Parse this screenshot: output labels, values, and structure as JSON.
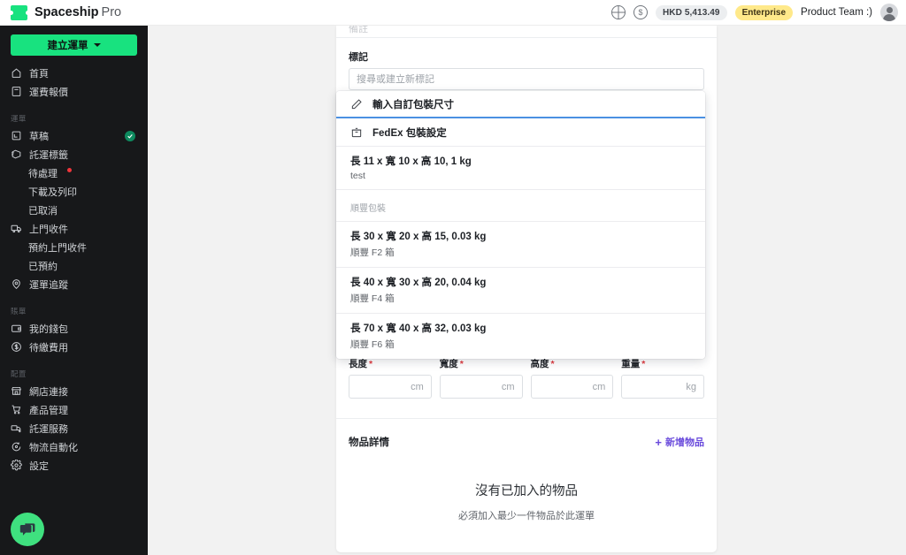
{
  "topbar": {
    "brand_bold": "Spaceship",
    "brand_light": "Pro",
    "globe_icon": "globe-icon",
    "currency_icon": "dollar-circle-icon",
    "balance": "HKD 5,413.49",
    "plan": "Enterprise",
    "user": "Product Team :)",
    "avatar_icon": "user-avatar-icon"
  },
  "sidebar": {
    "create_button": "建立運單",
    "primary": [
      {
        "label": "首頁",
        "icon": "home-icon"
      },
      {
        "label": "運費報價",
        "icon": "calculator-icon"
      }
    ],
    "groups": [
      {
        "label": "運單",
        "items": [
          {
            "label": "草稿",
            "icon": "draft-icon",
            "badge": "check"
          },
          {
            "label": "託運標籤",
            "icon": "label-tag-icon"
          },
          {
            "label": "待處理",
            "sub": true,
            "badge": "dot"
          },
          {
            "label": "下載及列印",
            "sub": true
          },
          {
            "label": "已取消",
            "sub": true
          },
          {
            "label": "上門收件",
            "icon": "truck-icon"
          },
          {
            "label": "預約上門收件",
            "sub": true
          },
          {
            "label": "已預約",
            "sub": true
          },
          {
            "label": "運單追蹤",
            "icon": "location-pin-icon"
          }
        ]
      },
      {
        "label": "賬單",
        "items": [
          {
            "label": "我的錢包",
            "icon": "wallet-icon"
          },
          {
            "label": "待繳費用",
            "icon": "dollar-circle-icon"
          }
        ]
      },
      {
        "label": "配置",
        "items": [
          {
            "label": "網店連接",
            "icon": "storefront-icon"
          },
          {
            "label": "產品管理",
            "icon": "cart-icon"
          },
          {
            "label": "託運服務",
            "icon": "shipping-service-icon"
          },
          {
            "label": "物流自動化",
            "icon": "automation-icon"
          },
          {
            "label": "設定",
            "icon": "gear-icon"
          }
        ]
      }
    ],
    "chat_icon": "chat-bubble-icon"
  },
  "form": {
    "clipped_label": "備註",
    "tag_label": "標記",
    "tag_placeholder": "搜尋或建立新標記",
    "package_select_value": "輸入自訂包裝尺寸",
    "dims": [
      {
        "label": "長度",
        "required": "*",
        "unit": "cm",
        "value": ""
      },
      {
        "label": "寬度",
        "required": "*",
        "unit": "cm",
        "value": ""
      },
      {
        "label": "高度",
        "required": "*",
        "unit": "cm",
        "value": ""
      },
      {
        "label": "重量",
        "required": "*",
        "unit": "kg",
        "value": ""
      }
    ]
  },
  "dropdown": {
    "custom_entry": {
      "label": "輸入自訂包裝尺寸",
      "icon": "pencil-icon"
    },
    "fedex_entry": {
      "label": "FedEx 包裝設定",
      "icon": "package-box-icon"
    },
    "saved": [
      {
        "title": "長 11 x 寬 10 x 高 10, 1 kg",
        "subtitle": "test"
      }
    ],
    "group_label": "順豐包裝",
    "group_options": [
      {
        "title": "長 30 x 寬 20 x 高 15, 0.03 kg",
        "subtitle": "順豐 F2 箱"
      },
      {
        "title": "長 40 x 寬 30 x 高 20, 0.04 kg",
        "subtitle": "順豐 F4 箱"
      },
      {
        "title": "長 70 x 寬 40 x 高 32, 0.03 kg",
        "subtitle": "順豐 F6 箱"
      }
    ]
  },
  "items_section": {
    "title": "物品詳情",
    "add_label": "新增物品",
    "add_icon": "plus-icon",
    "empty_title": "沒有已加入的物品",
    "empty_subtitle": "必須加入最少一件物品於此運單"
  },
  "colors": {
    "accent_green": "#18e27f",
    "sidebar_bg": "#17181a",
    "link_purple": "#6a4bdc",
    "plan_badge": "#ffe98a",
    "required_red": "#e0393f",
    "focus_blue": "#4a90e2"
  }
}
